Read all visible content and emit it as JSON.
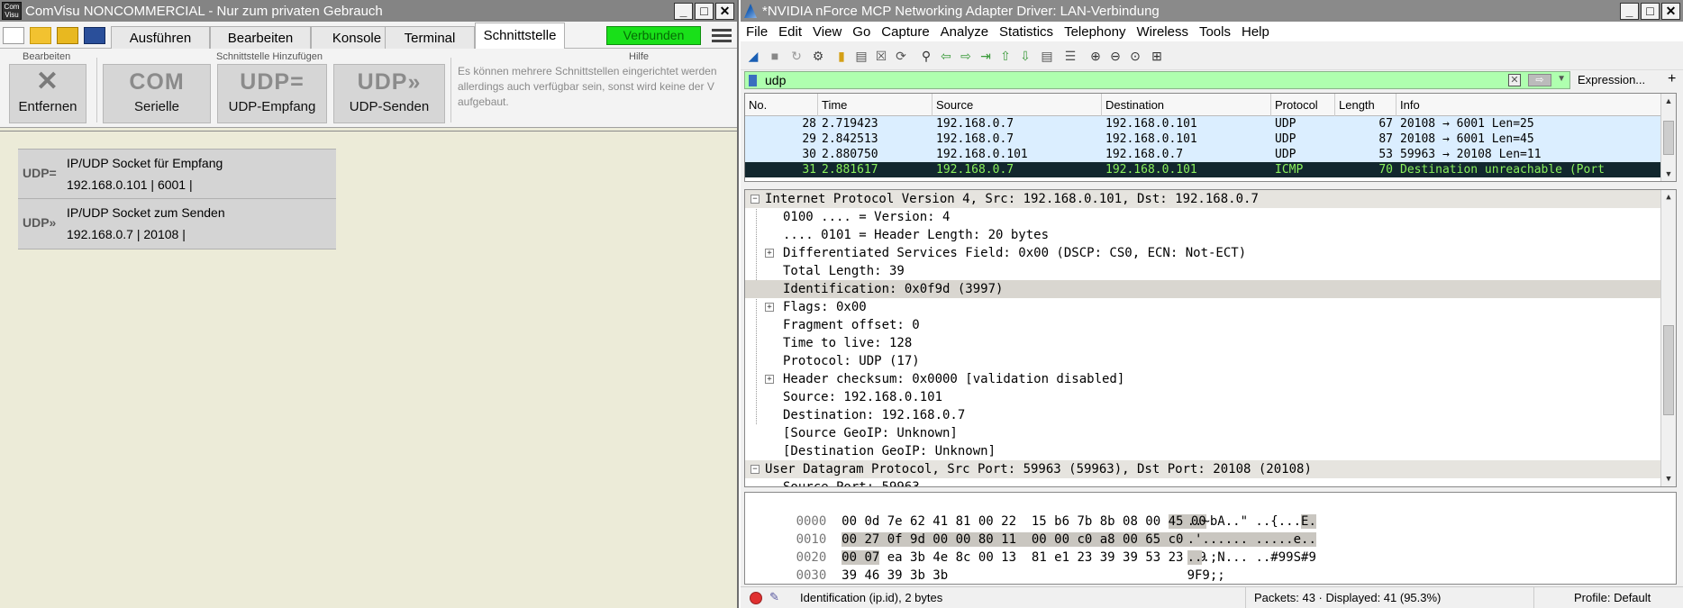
{
  "comvisu": {
    "title": "ComVisu NONCOMMERCIAL - Nur zum privaten Gebrauch",
    "app_icon_text": "Com Visu",
    "tabs": [
      "Ausführen",
      "Bearbeiten",
      "Konsole",
      "Terminal",
      "Schnittstelle"
    ],
    "active_tab": "Schnittstelle",
    "connection_status": "Verbunden",
    "ribbon": {
      "group_edit": "Bearbeiten",
      "group_add": "Schnittstelle Hinzufügen",
      "group_help": "Hilfe",
      "remove_label": "Entfernen",
      "com_big": "COM",
      "com_label": "Serielle",
      "udp_recv_big": "UDP=",
      "udp_recv_label": "UDP-Empfang",
      "udp_send_big": "UDP»",
      "udp_send_label": "UDP-Senden",
      "help_line1": "Es können mehrere Schnittstellen eingerichtet werden",
      "help_line2": "allerdings auch verfügbar sein, sonst wird keine der V",
      "help_line3": "aufgebaut."
    },
    "interfaces": [
      {
        "icon": "UDP=",
        "title": "IP/UDP Socket für Empfang",
        "detail": "192.168.0.101 | 6001 |"
      },
      {
        "icon": "UDP»",
        "title": "IP/UDP Socket zum Senden",
        "detail": "192.168.0.7 | 20108 |"
      }
    ]
  },
  "wireshark": {
    "title": "*NVIDIA nForce MCP Networking Adapter Driver: LAN-Verbindung",
    "menu": [
      "File",
      "Edit",
      "View",
      "Go",
      "Capture",
      "Analyze",
      "Statistics",
      "Telephony",
      "Wireless",
      "Tools",
      "Help"
    ],
    "filter_value": "udp",
    "expression_label": "Expression...",
    "plus_label": "+",
    "columns": [
      "No.",
      "Time",
      "Source",
      "Destination",
      "Protocol",
      "Length",
      "Info"
    ],
    "packets": [
      {
        "no": "28",
        "time": "2.719423",
        "src": "192.168.0.7",
        "dst": "192.168.0.101",
        "proto": "UDP",
        "len": "67",
        "info": "20108 → 6001  Len=25"
      },
      {
        "no": "29",
        "time": "2.842513",
        "src": "192.168.0.7",
        "dst": "192.168.0.101",
        "proto": "UDP",
        "len": "87",
        "info": "20108 → 6001  Len=45"
      },
      {
        "no": "30",
        "time": "2.880750",
        "src": "192.168.0.101",
        "dst": "192.168.0.7",
        "proto": "UDP",
        "len": "53",
        "info": "59963 → 20108  Len=11"
      },
      {
        "no": "31",
        "time": "2.881617",
        "src": "192.168.0.7",
        "dst": "192.168.0.101",
        "proto": "ICMP",
        "len": "70",
        "info": "Destination unreachable (Port"
      }
    ],
    "details": [
      "Internet Protocol Version 4, Src: 192.168.0.101, Dst: 192.168.0.7",
      "0100 .... = Version: 4",
      ".... 0101 = Header Length: 20 bytes",
      "Differentiated Services Field: 0x00 (DSCP: CS0, ECN: Not-ECT)",
      "Total Length: 39",
      "Identification: 0x0f9d (3997)",
      "Flags: 0x00",
      "Fragment offset: 0",
      "Time to live: 128",
      "Protocol: UDP (17)",
      "Header checksum: 0x0000 [validation disabled]",
      "Source: 192.168.0.101",
      "Destination: 192.168.0.7",
      "[Source GeoIP: Unknown]",
      "[Destination GeoIP: Unknown]",
      "User Datagram Protocol, Src Port: 59963 (59963), Dst Port: 20108 (20108)",
      "Source Port: 59963"
    ],
    "bytes": [
      {
        "offset": "0000",
        "hex_a": "00 0d 7e 62 41 81 00 22  15 b6 7b 8b 08 00 ",
        "hex_hl": "45 00",
        "hex_b": "",
        "ascii_a": "..~bA..\" ..{...",
        "ascii_hl": "E.",
        "ascii_b": ""
      },
      {
        "offset": "0010",
        "hex_a": "",
        "hex_hl": "00 27 0f 9d 00 00 80 11  00 00 c0 a8 00 65 c0 a8",
        "hex_b": "",
        "ascii_a": "",
        "ascii_hl": ".'...... .....e..",
        "ascii_b": ""
      },
      {
        "offset": "0020",
        "hex_a": "",
        "hex_hl": "00 07",
        "hex_b": " ea 3b 4e 8c 00 13  81 e1 23 39 39 53 23 39",
        "ascii_a": "",
        "ascii_hl": "..",
        "ascii_b": ".;N... ..#99S#9"
      },
      {
        "offset": "0030",
        "hex_a": "39 46 39 3b 3b",
        "hex_hl": "",
        "hex_b": "",
        "ascii_a": "9F9;;",
        "ascii_hl": "",
        "ascii_b": ""
      }
    ],
    "status": {
      "field_info": "Identification (ip.id), 2 bytes",
      "packets": "Packets: 43 · Displayed: 41 (95.3%)",
      "profile": "Profile: Default"
    }
  }
}
